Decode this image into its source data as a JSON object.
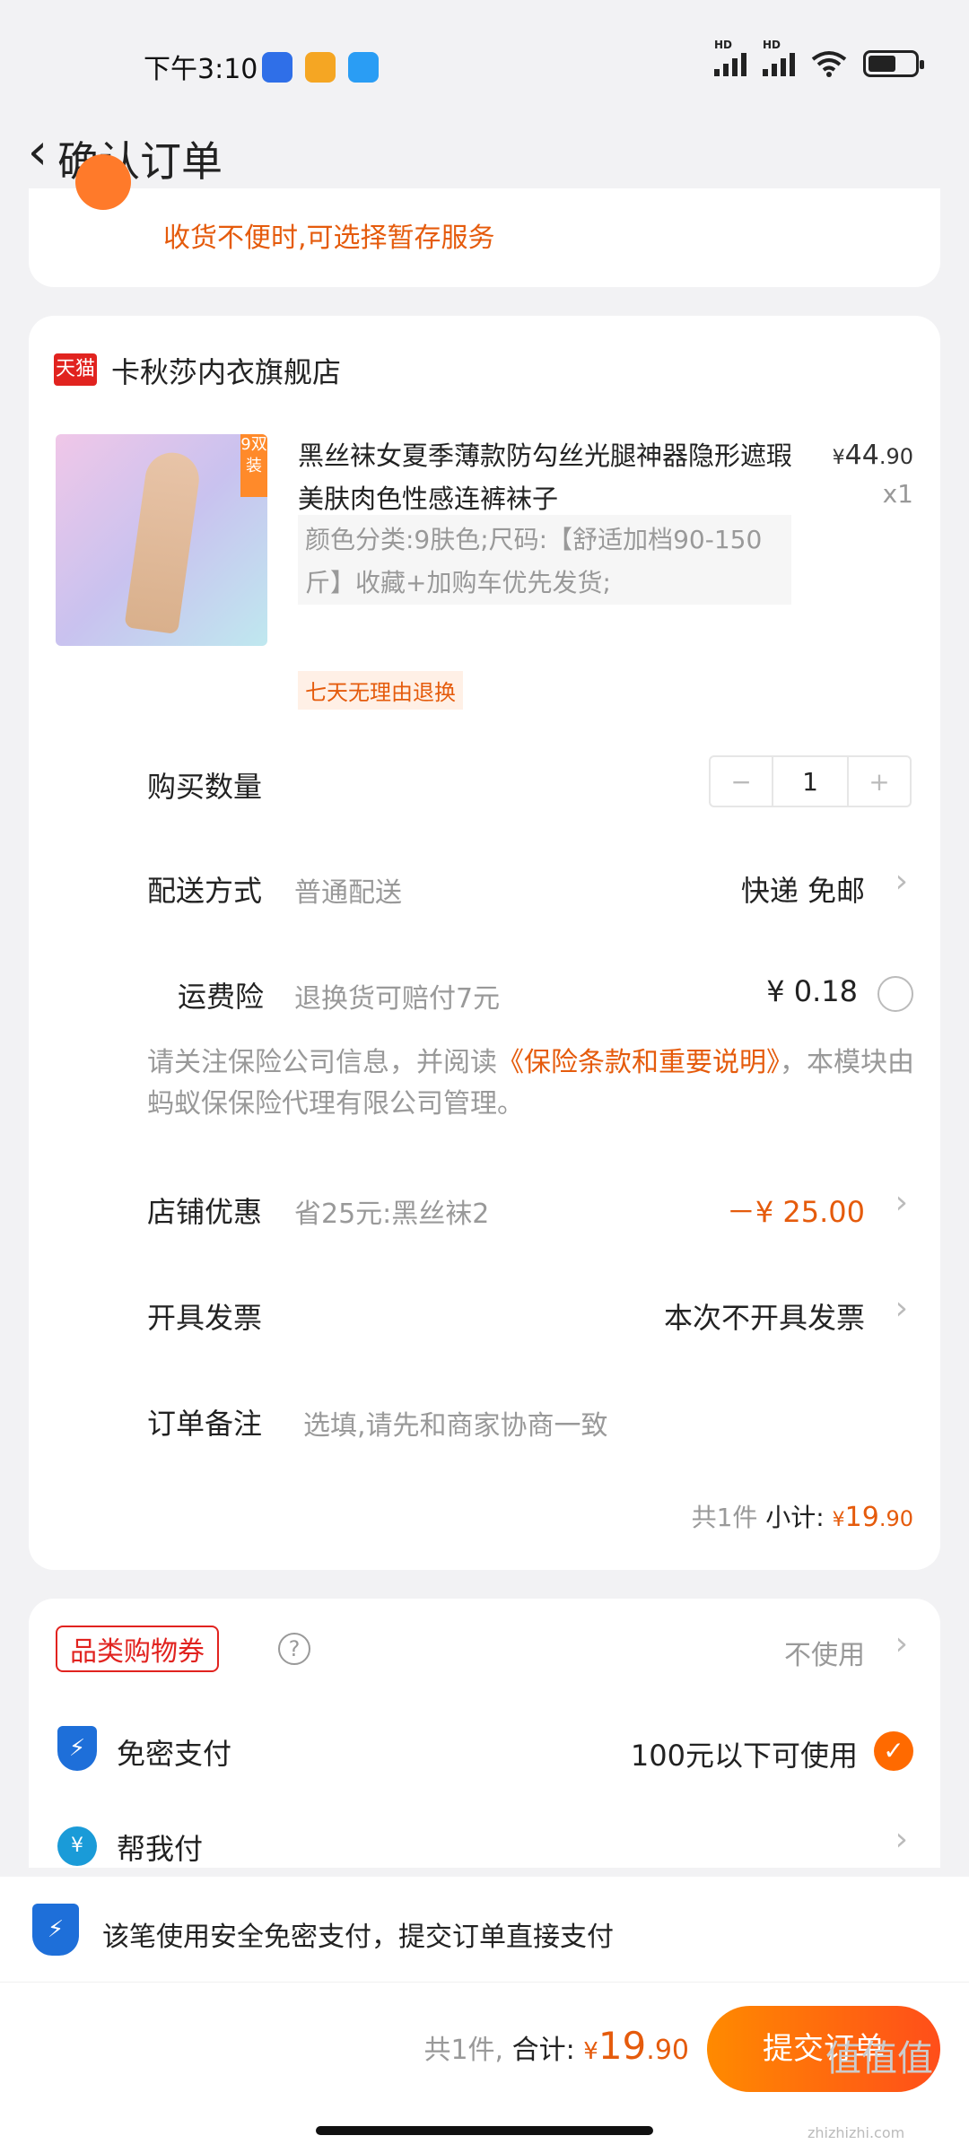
{
  "status_bar": {
    "time": "下午3:10",
    "signal1_label": "HD",
    "signal2_label": "HD"
  },
  "nav": {
    "back": "‹",
    "title": "确认订单"
  },
  "delivery_notice": "收货不便时,可选择暂存服务",
  "shop": {
    "badge": "天猫",
    "name": "卡秋莎内衣旗舰店"
  },
  "product": {
    "title": "黑丝袜女夏季薄款防勾丝光腿神器隐形遮瑕美肤肉色性感连裤袜子",
    "price_symbol": "¥",
    "price_int": "44",
    "price_dec": ".90",
    "qty": "x1",
    "spec": "颜色分类:9肤色;尺码:【舒适加档90-150斤】收藏+加购车优先发货;",
    "return_tag": "七天无理由退换",
    "image_tag": "9双装"
  },
  "quantity": {
    "label": "购买数量",
    "minus": "−",
    "value": "1",
    "plus": "+"
  },
  "shipping": {
    "label": "配送方式",
    "sub": "普通配送",
    "value": "快递 免邮"
  },
  "insurance": {
    "label": "运费险",
    "sub": "退换货可赔付7元",
    "value": "¥ 0.18",
    "note_prefix": "请关注保险公司信息，并阅读",
    "note_link": "《保险条款和重要说明》",
    "note_suffix": "，本模块由蚂蚁保保险代理有限公司管理。"
  },
  "store_discount": {
    "label": "店铺优惠",
    "sub": "省25元:黑丝袜2",
    "value": "－¥ 25.00"
  },
  "invoice": {
    "label": "开具发票",
    "value": "本次不开具发票"
  },
  "remark": {
    "label": "订单备注",
    "placeholder": "选填,请先和商家协商一致"
  },
  "subtotal": {
    "count": "共1件",
    "label": "小计:",
    "symbol": "¥",
    "int": "19",
    "dec": ".90"
  },
  "coupon": {
    "tag": "品类购物券",
    "help": "?",
    "value": "不使用"
  },
  "password_free": {
    "label": "免密支付",
    "value": "100元以下可使用"
  },
  "help_pay": {
    "label": "帮我付",
    "icon_text": "¥"
  },
  "bottom_notice": "该笔使用安全免密支付，提交订单直接支付",
  "total": {
    "count": "共1件,",
    "label": "合计:",
    "symbol": "¥",
    "int": "19",
    "dec": ".90"
  },
  "submit_label": "提交订单",
  "watermark": "值值值",
  "watermark_url": "zhizhizhi.com",
  "colors": {
    "accent": "#e55b0c",
    "tmall": "#e1231f",
    "shield": "#1e6fd9",
    "submit_start": "#ff8a00",
    "submit_end": "#ff4e1a"
  }
}
